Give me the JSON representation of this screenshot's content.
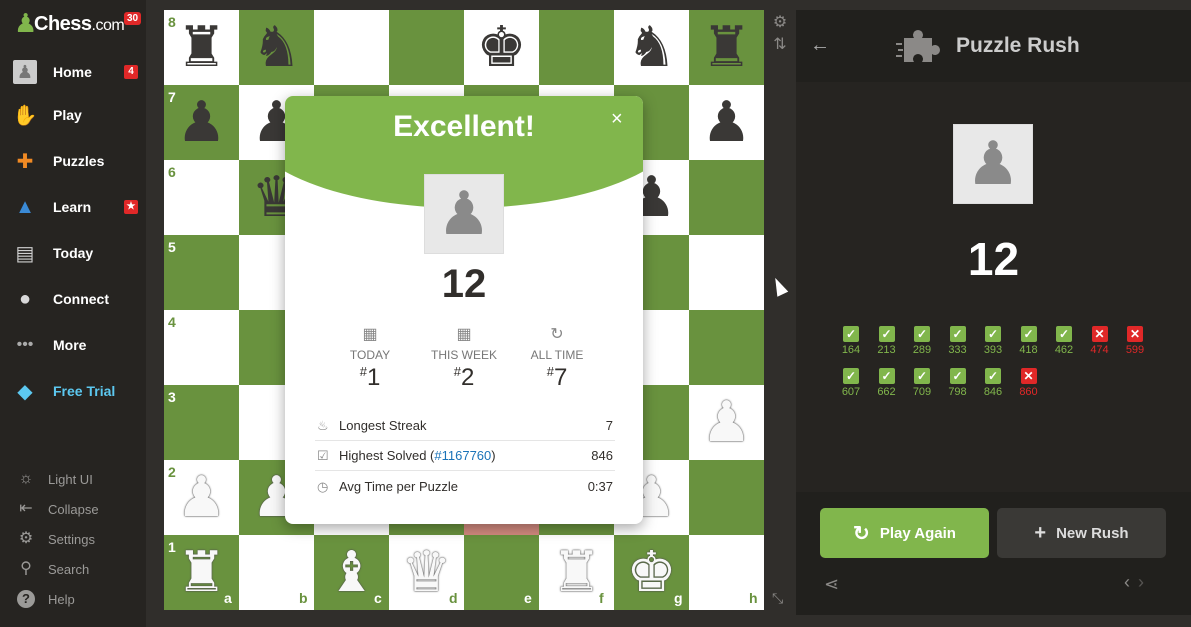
{
  "brand": {
    "name": "Chess",
    "suffix": ".com",
    "badge": "30"
  },
  "nav": [
    {
      "label": "Home",
      "icon": "home-avatar-icon",
      "badge": "4"
    },
    {
      "label": "Play",
      "icon": "play-icon",
      "badge": ""
    },
    {
      "label": "Puzzles",
      "icon": "puzzle-icon",
      "badge": ""
    },
    {
      "label": "Learn",
      "icon": "learn-icon",
      "badge": "★"
    },
    {
      "label": "Today",
      "icon": "news-icon",
      "badge": ""
    },
    {
      "label": "Connect",
      "icon": "chat-icon",
      "badge": ""
    },
    {
      "label": "More",
      "icon": "more-icon",
      "badge": ""
    },
    {
      "label": "Free Trial",
      "icon": "diamond-icon",
      "badge": ""
    }
  ],
  "bottom_nav": [
    {
      "label": "Light UI",
      "icon": "sun-icon"
    },
    {
      "label": "Collapse",
      "icon": "collapse-icon"
    },
    {
      "label": "Settings",
      "icon": "gear-icon"
    },
    {
      "label": "Search",
      "icon": "search-icon"
    },
    {
      "label": "Help",
      "icon": "help-icon"
    }
  ],
  "board": {
    "ranks": [
      "8",
      "7",
      "6",
      "5",
      "4",
      "3",
      "2",
      "1"
    ],
    "files": [
      "a",
      "b",
      "c",
      "d",
      "e",
      "f",
      "g",
      "h"
    ],
    "pieces": [
      "r n . . k . n r",
      "p p . . . . . p",
      ". q . . . . p .",
      ". . . . . . . .",
      ". . . . . . . .",
      ". . . . . . . P",
      "P P . . . . P .",
      "R . B Q . R K ."
    ]
  },
  "modal": {
    "title": "Excellent!",
    "close": "×",
    "score": "12",
    "ranks": [
      {
        "label": "TODAY",
        "value": "1"
      },
      {
        "label": "THIS WEEK",
        "value": "2"
      },
      {
        "label": "ALL TIME",
        "value": "7"
      }
    ],
    "stats": [
      {
        "label": "Longest Streak",
        "link": "",
        "value": "7"
      },
      {
        "label": "Highest Solved (",
        "link": "#1167760",
        "suffix": ")",
        "value": "846"
      },
      {
        "label": "Avg Time per Puzzle",
        "link": "",
        "value": "0:37"
      }
    ]
  },
  "panel": {
    "title": "Puzzle Rush",
    "score": "12",
    "results": [
      {
        "rating": "164",
        "ok": true
      },
      {
        "rating": "213",
        "ok": true
      },
      {
        "rating": "289",
        "ok": true
      },
      {
        "rating": "333",
        "ok": true
      },
      {
        "rating": "393",
        "ok": true
      },
      {
        "rating": "418",
        "ok": true
      },
      {
        "rating": "462",
        "ok": true
      },
      {
        "rating": "474",
        "ok": false
      },
      {
        "rating": "599",
        "ok": false
      },
      {
        "rating": "607",
        "ok": true
      },
      {
        "rating": "662",
        "ok": true
      },
      {
        "rating": "709",
        "ok": true
      },
      {
        "rating": "798",
        "ok": true
      },
      {
        "rating": "846",
        "ok": true
      },
      {
        "rating": "860",
        "ok": false
      }
    ],
    "play_again": "Play Again",
    "new_rush": "New Rush"
  },
  "colors": {
    "green": "#81b64c",
    "red": "#e02828",
    "dark_square": "#69923e"
  }
}
